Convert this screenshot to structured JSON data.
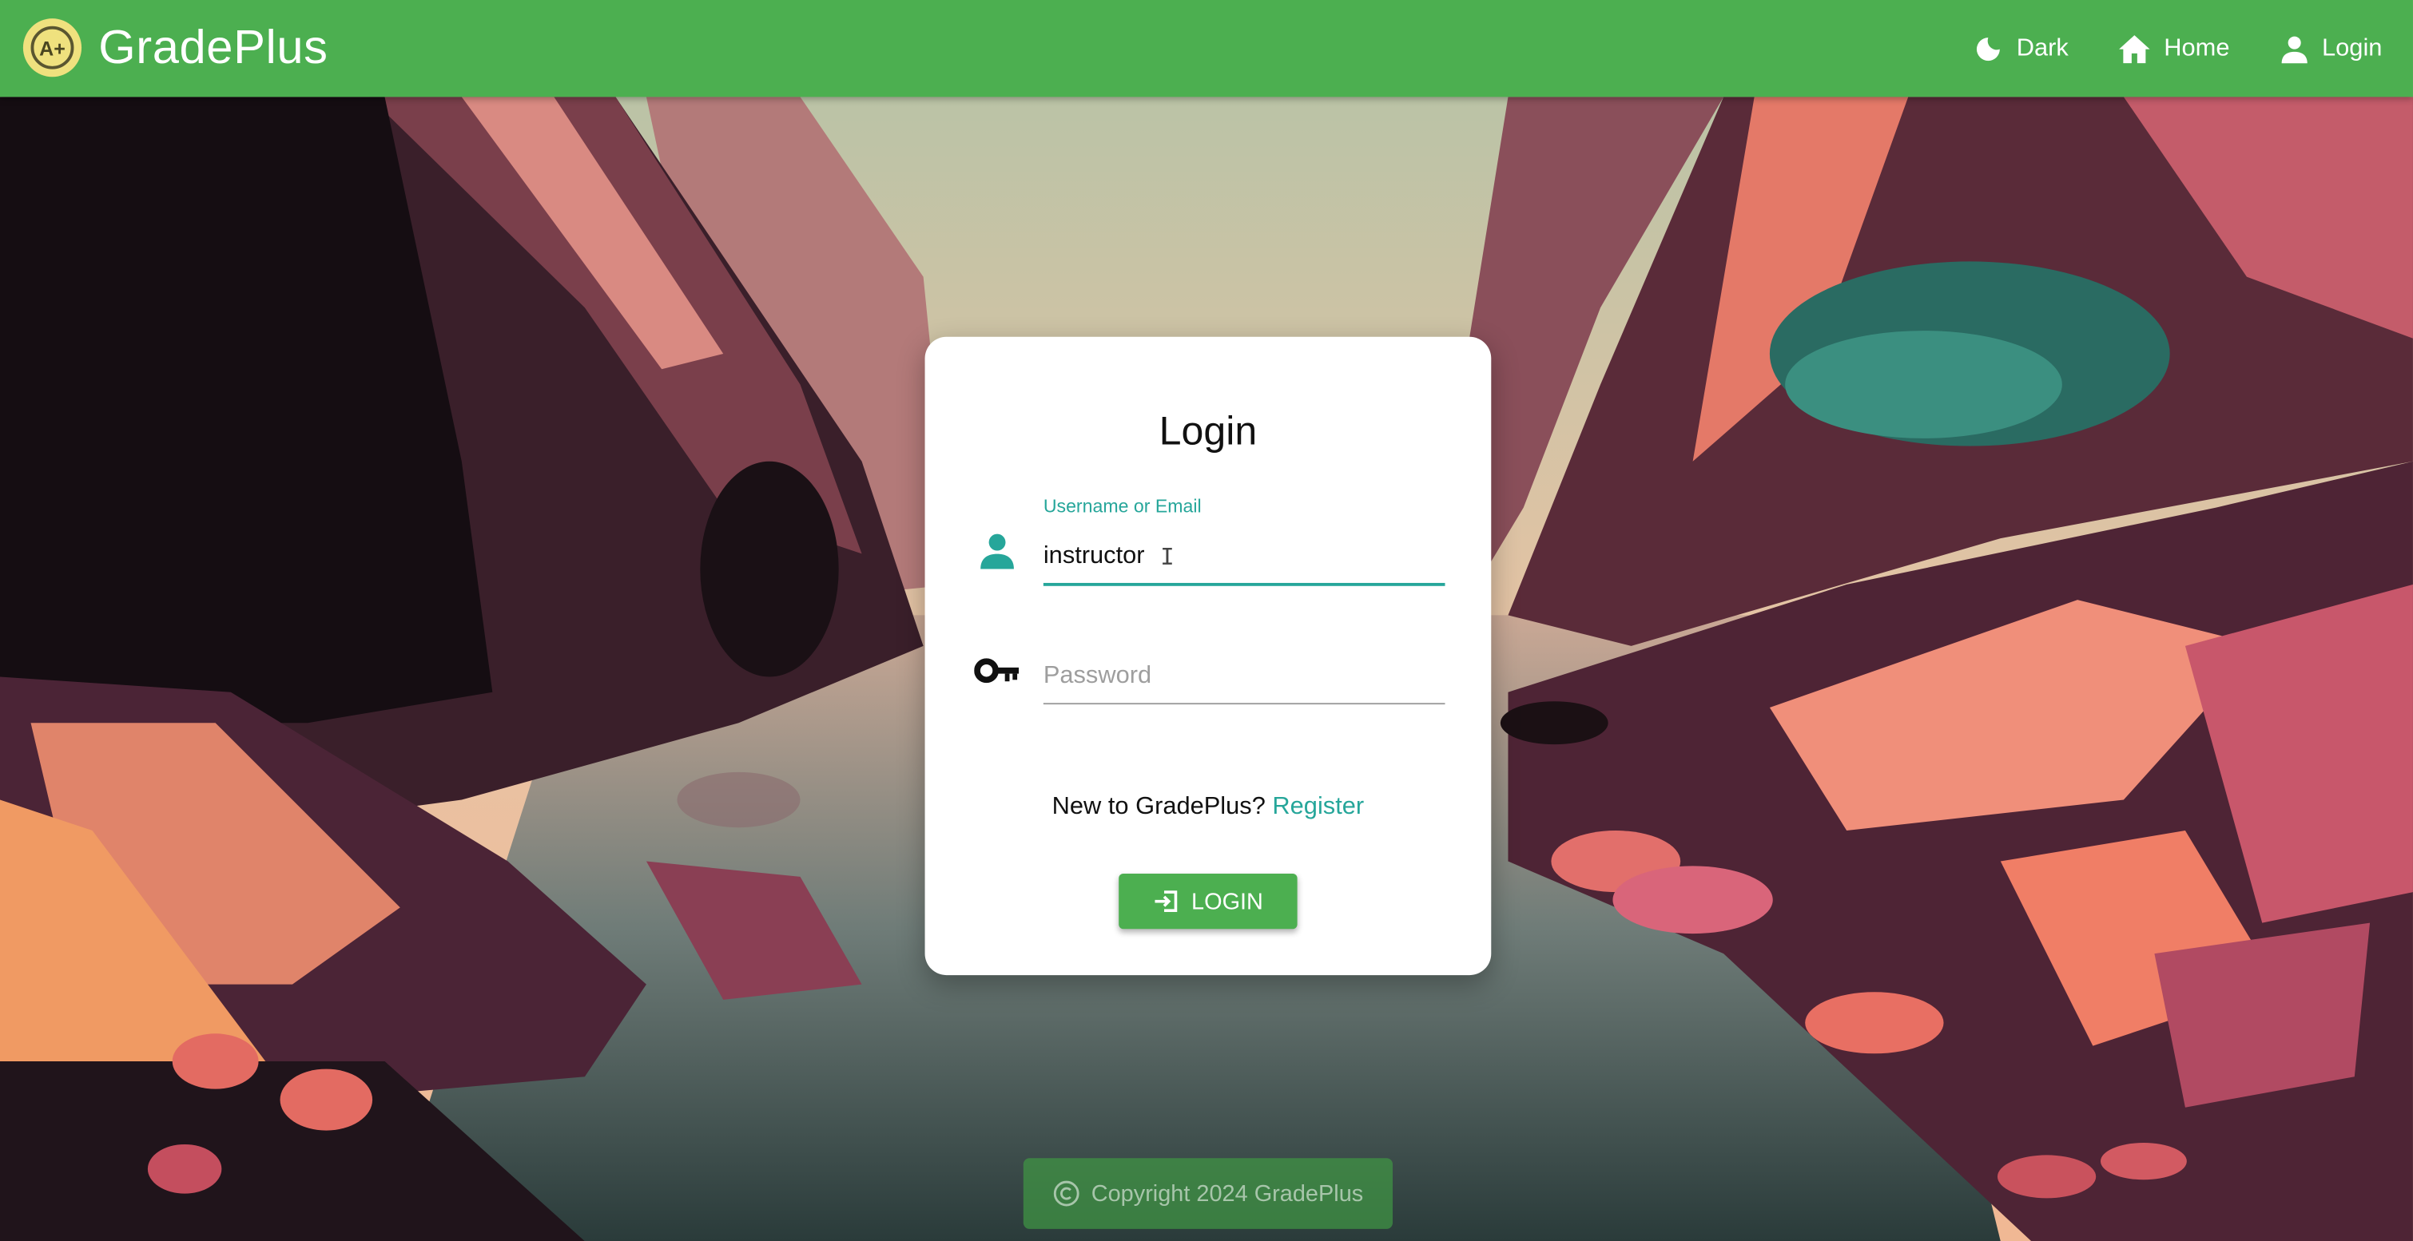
{
  "app": {
    "name": "GradePlus",
    "logo_text": "A+"
  },
  "nav": {
    "items": [
      {
        "label": "Dark",
        "icon": "moon-icon"
      },
      {
        "label": "Home",
        "icon": "home-icon"
      },
      {
        "label": "Login",
        "icon": "person-icon"
      }
    ]
  },
  "login_form": {
    "title": "Login",
    "username_label": "Username or Email",
    "username_value": "instructor",
    "password_placeholder": "Password",
    "register_prompt": "New to GradePlus?",
    "register_link": "Register",
    "submit_label": "LOGIN"
  },
  "footer": {
    "text": "Copyright 2024 GradePlus"
  },
  "colors": {
    "primary": "#4caf50",
    "accent": "#26a69a",
    "logo": "#efe17e"
  }
}
